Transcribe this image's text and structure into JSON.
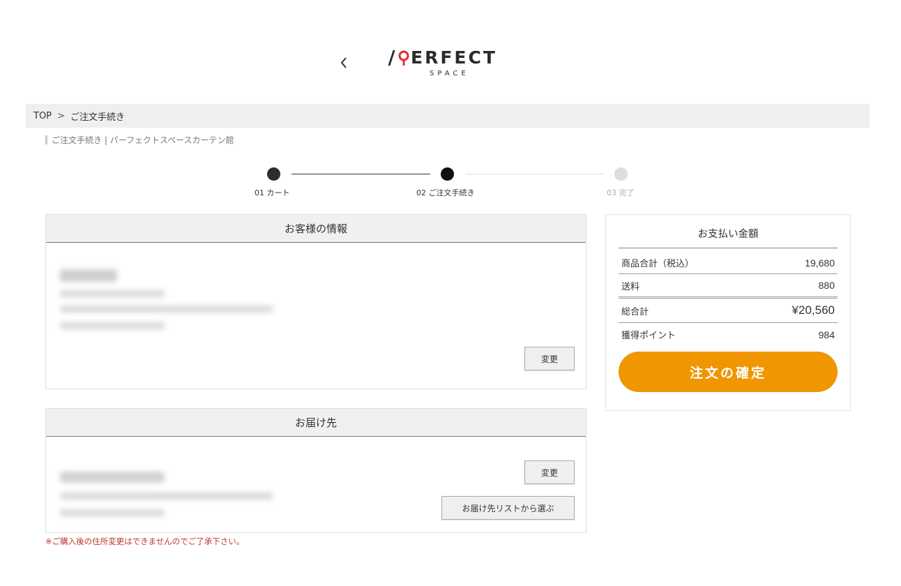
{
  "header": {
    "logo_main": "ERFECT",
    "logo_sub": "SPACE",
    "back_label": "‹"
  },
  "breadcrumb": {
    "home": "TOP",
    "separator": ">",
    "current": "ご注文手続き"
  },
  "page_heading": "ご注文手続き | パーフェクトスペースカーテン館",
  "steps": [
    {
      "label": "01 カート",
      "state": "done"
    },
    {
      "label": "02 ご注文手続き",
      "state": "current"
    },
    {
      "label": "03 完了",
      "state": "upcoming"
    }
  ],
  "customer": {
    "title": "お客様の情報",
    "change_label": "変更"
  },
  "delivery": {
    "title": "お届け先",
    "change_label": "変更",
    "choose_label": "お届け先リストから選ぶ"
  },
  "notice": "※ご購入後の住所変更はできませんのでご了承下さい。",
  "summary": {
    "title": "お支払い金額",
    "rows": [
      {
        "label": "商品合計（税込）",
        "value": "19,680"
      },
      {
        "label": "送料",
        "value": "880"
      },
      {
        "label": "総合計",
        "value": "¥20,560"
      },
      {
        "label": "獲得ポイント",
        "value": "984"
      }
    ],
    "confirm_label": "注文の確定"
  },
  "colors": {
    "accent": "#ef9600",
    "notice": "#c0392b",
    "logo_pin": "#d9302c",
    "step_active": "#111111",
    "step_inactive": "#dddddd"
  },
  "icons": {
    "back": "chevron-left-icon",
    "logo_pin": "map-pin-icon"
  }
}
